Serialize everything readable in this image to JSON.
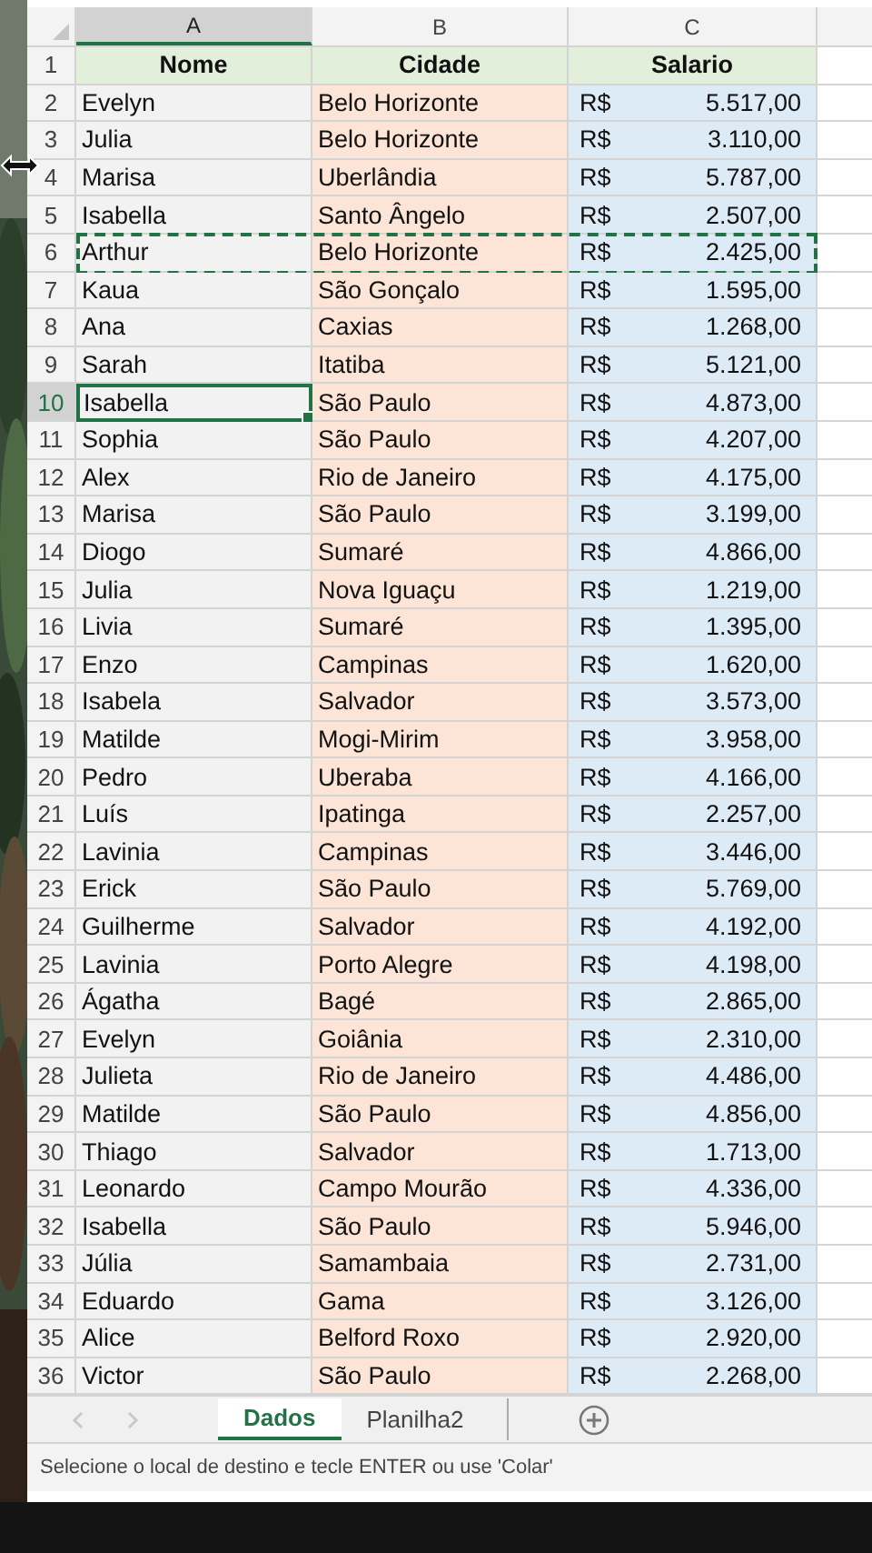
{
  "columns": [
    {
      "label": "A",
      "selected": true
    },
    {
      "label": "B",
      "selected": false
    },
    {
      "label": "C",
      "selected": false
    }
  ],
  "header": {
    "number": "1",
    "cells": [
      "Nome",
      "Cidade",
      "Salario"
    ]
  },
  "rows": [
    {
      "number": "2",
      "name": "Evelyn",
      "city": "Belo Horizonte",
      "currency": "R$",
      "salary": "5.517,00",
      "selected": false,
      "copied": false
    },
    {
      "number": "3",
      "name": "Julia",
      "city": "Belo Horizonte",
      "currency": "R$",
      "salary": "3.110,00",
      "selected": false,
      "copied": false
    },
    {
      "number": "4",
      "name": "Marisa",
      "city": "Uberlândia",
      "currency": "R$",
      "salary": "5.787,00",
      "selected": false,
      "copied": false
    },
    {
      "number": "5",
      "name": "Isabella",
      "city": "Santo Ângelo",
      "currency": "R$",
      "salary": "2.507,00",
      "selected": false,
      "copied": false
    },
    {
      "number": "6",
      "name": "Arthur",
      "city": "Belo Horizonte",
      "currency": "R$",
      "salary": "2.425,00",
      "selected": false,
      "copied": true
    },
    {
      "number": "7",
      "name": "Kaua",
      "city": "São Gonçalo",
      "currency": "R$",
      "salary": "1.595,00",
      "selected": false,
      "copied": false
    },
    {
      "number": "8",
      "name": "Ana",
      "city": "Caxias",
      "currency": "R$",
      "salary": "1.268,00",
      "selected": false,
      "copied": false
    },
    {
      "number": "9",
      "name": "Sarah",
      "city": "Itatiba",
      "currency": "R$",
      "salary": "5.121,00",
      "selected": false,
      "copied": false
    },
    {
      "number": "10",
      "name": "Isabella",
      "city": "São Paulo",
      "currency": "R$",
      "salary": "4.873,00",
      "selected": true,
      "copied": false
    },
    {
      "number": "11",
      "name": "Sophia",
      "city": "São Paulo",
      "currency": "R$",
      "salary": "4.207,00",
      "selected": false,
      "copied": false
    },
    {
      "number": "12",
      "name": "Alex",
      "city": "Rio de Janeiro",
      "currency": "R$",
      "salary": "4.175,00",
      "selected": false,
      "copied": false
    },
    {
      "number": "13",
      "name": "Marisa",
      "city": "São Paulo",
      "currency": "R$",
      "salary": "3.199,00",
      "selected": false,
      "copied": false
    },
    {
      "number": "14",
      "name": "Diogo",
      "city": "Sumaré",
      "currency": "R$",
      "salary": "4.866,00",
      "selected": false,
      "copied": false
    },
    {
      "number": "15",
      "name": "Julia",
      "city": "Nova Iguaçu",
      "currency": "R$",
      "salary": "1.219,00",
      "selected": false,
      "copied": false
    },
    {
      "number": "16",
      "name": "Livia",
      "city": "Sumaré",
      "currency": "R$",
      "salary": "1.395,00",
      "selected": false,
      "copied": false
    },
    {
      "number": "17",
      "name": "Enzo",
      "city": "Campinas",
      "currency": "R$",
      "salary": "1.620,00",
      "selected": false,
      "copied": false
    },
    {
      "number": "18",
      "name": "Isabela",
      "city": "Salvador",
      "currency": "R$",
      "salary": "3.573,00",
      "selected": false,
      "copied": false
    },
    {
      "number": "19",
      "name": "Matilde",
      "city": "Mogi-Mirim",
      "currency": "R$",
      "salary": "3.958,00",
      "selected": false,
      "copied": false
    },
    {
      "number": "20",
      "name": "Pedro",
      "city": "Uberaba",
      "currency": "R$",
      "salary": "4.166,00",
      "selected": false,
      "copied": false
    },
    {
      "number": "21",
      "name": "Luís",
      "city": "Ipatinga",
      "currency": "R$",
      "salary": "2.257,00",
      "selected": false,
      "copied": false
    },
    {
      "number": "22",
      "name": "Lavinia",
      "city": "Campinas",
      "currency": "R$",
      "salary": "3.446,00",
      "selected": false,
      "copied": false
    },
    {
      "number": "23",
      "name": "Erick",
      "city": "São Paulo",
      "currency": "R$",
      "salary": "5.769,00",
      "selected": false,
      "copied": false
    },
    {
      "number": "24",
      "name": "Guilherme",
      "city": "Salvador",
      "currency": "R$",
      "salary": "4.192,00",
      "selected": false,
      "copied": false
    },
    {
      "number": "25",
      "name": "Lavinia",
      "city": "Porto Alegre",
      "currency": "R$",
      "salary": "4.198,00",
      "selected": false,
      "copied": false
    },
    {
      "number": "26",
      "name": "Ágatha",
      "city": "Bagé",
      "currency": "R$",
      "salary": "2.865,00",
      "selected": false,
      "copied": false
    },
    {
      "number": "27",
      "name": "Evelyn",
      "city": "Goiânia",
      "currency": "R$",
      "salary": "2.310,00",
      "selected": false,
      "copied": false
    },
    {
      "number": "28",
      "name": "Julieta",
      "city": "Rio de Janeiro",
      "currency": "R$",
      "salary": "4.486,00",
      "selected": false,
      "copied": false
    },
    {
      "number": "29",
      "name": "Matilde",
      "city": "São Paulo",
      "currency": "R$",
      "salary": "4.856,00",
      "selected": false,
      "copied": false
    },
    {
      "number": "30",
      "name": "Thiago",
      "city": "Salvador",
      "currency": "R$",
      "salary": "1.713,00",
      "selected": false,
      "copied": false
    },
    {
      "number": "31",
      "name": "Leonardo",
      "city": "Campo Mourão",
      "currency": "R$",
      "salary": "4.336,00",
      "selected": false,
      "copied": false
    },
    {
      "number": "32",
      "name": "Isabella",
      "city": "São Paulo",
      "currency": "R$",
      "salary": "5.946,00",
      "selected": false,
      "copied": false
    },
    {
      "number": "33",
      "name": "Júlia",
      "city": "Samambaia",
      "currency": "R$",
      "salary": "2.731,00",
      "selected": false,
      "copied": false
    },
    {
      "number": "34",
      "name": "Eduardo",
      "city": "Gama",
      "currency": "R$",
      "salary": "3.126,00",
      "selected": false,
      "copied": false
    },
    {
      "number": "35",
      "name": "Alice",
      "city": "Belford Roxo",
      "currency": "R$",
      "salary": "2.920,00",
      "selected": false,
      "copied": false
    },
    {
      "number": "36",
      "name": "Victor",
      "city": "São Paulo",
      "currency": "R$",
      "salary": "2.268,00",
      "selected": false,
      "copied": false
    }
  ],
  "sheet_tabs": [
    {
      "label": "Dados",
      "selected": true
    },
    {
      "label": "Planilha2",
      "selected": false
    }
  ],
  "status_bar": {
    "message": "Selecione o local de destino e tecle ENTER ou use 'Colar'"
  }
}
